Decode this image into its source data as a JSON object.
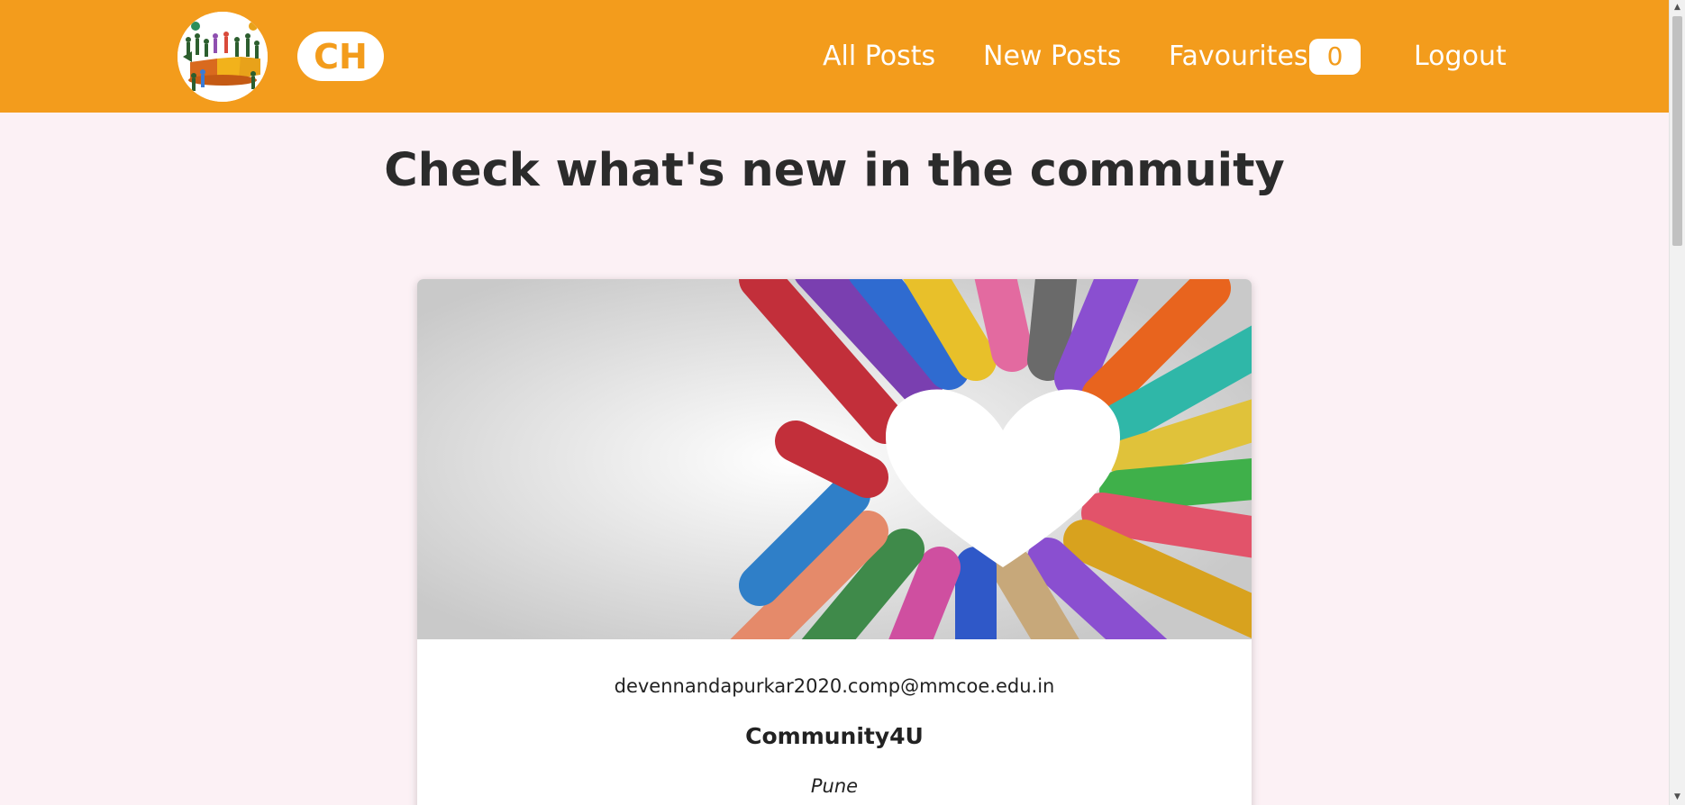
{
  "header": {
    "brand": "CH",
    "nav": {
      "all_posts": "All Posts",
      "new_posts": "New Posts",
      "favourites": "Favourites",
      "favourites_count": "0",
      "logout": "Logout"
    }
  },
  "main": {
    "title": "Check what's new in the commuity"
  },
  "post": {
    "email": "devennandapurkar2020.comp@mmcoe.edu.in",
    "name": "Community4U",
    "location": "Pune"
  },
  "colors": {
    "header_bg": "#f39c1c",
    "page_bg": "#fcf1f5",
    "title_text": "#2b2b2b"
  },
  "icons": {
    "logo": "community-logo-icon",
    "scroll_up": "scroll-up-arrow-icon",
    "scroll_down": "scroll-down-arrow-icon"
  }
}
